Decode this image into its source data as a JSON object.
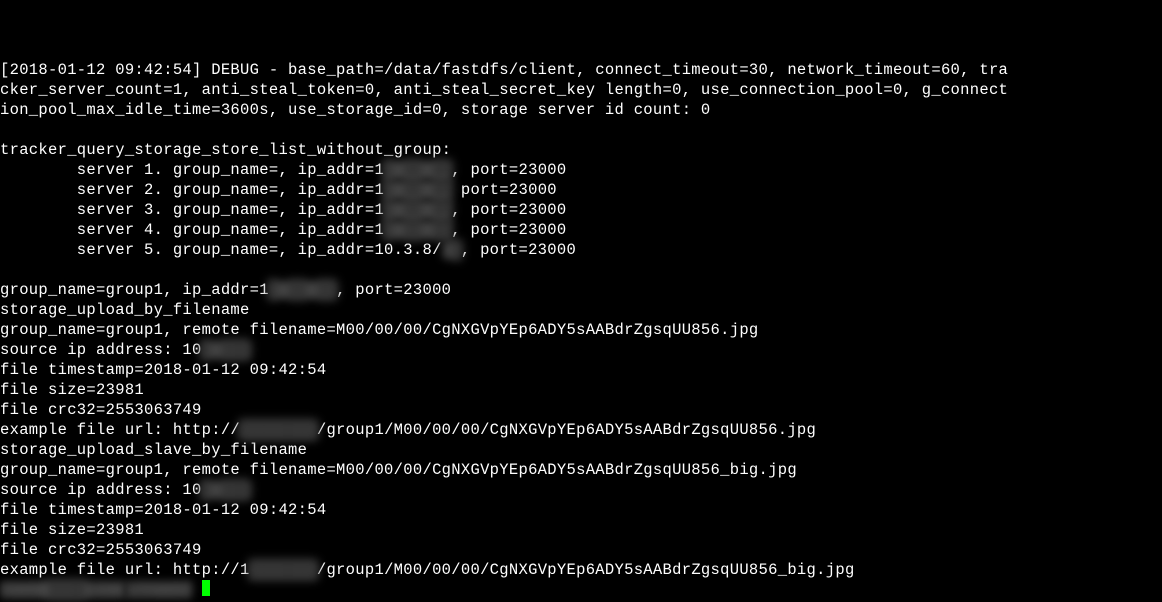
{
  "debug": {
    "ts": "[2018-01-12 09:42:54]",
    "level": "DEBUG",
    "base_path": "/data/fastdfs/client",
    "connect_timeout": "30",
    "network_timeout": "60",
    "tra": "tra",
    "cker_server_count": "cker_server_count=1",
    "anti_steal_token": "anti_steal_token=0",
    "anti_steal_secret_key_len": "anti_steal_secret_key length=0",
    "use_connection_pool": "use_connection_pool=0",
    "g_connect": "g_connect",
    "ion_pool_max_idle_time": "ion_pool_max_idle_time=3600s",
    "use_storage_id": "use_storage_id=0",
    "storage_server_id_count": "storage server id count: 0"
  },
  "tracker_header": "tracker_query_storage_store_list_without_group:",
  "servers": [
    {
      "idx": "1",
      "gn": "",
      "ip_prefix": "1",
      "ip_hidden": "█.██.██",
      "port": "23000",
      "tail": ","
    },
    {
      "idx": "2",
      "gn": "",
      "ip_prefix": "1",
      "ip_hidden": "█.██.██",
      "port": "23000",
      "tail": ""
    },
    {
      "idx": "3",
      "gn": "",
      "ip_prefix": "1",
      "ip_hidden": "█.██.██",
      "port": "23000",
      "tail": ","
    },
    {
      "idx": "4",
      "gn": "",
      "ip_prefix": "1",
      "ip_hidden": "█.██.██",
      "port": "23000",
      "tail": ","
    },
    {
      "idx": "5",
      "gn": "",
      "ip_prefix": "10.3.8/",
      "ip_hidden": ".█",
      "port": "23000",
      "tail": ","
    }
  ],
  "summary": {
    "group_name": "group1",
    "ip_prefix": "1",
    "ip_hidden": "█.██.██",
    "port": "23000"
  },
  "upload1": {
    "header": "storage_upload_by_filename",
    "group_name": "group1",
    "remote_filename": "M00/00/00/CgNXGVpYEp6ADY5sAABdrZgsqUU856.jpg",
    "source_ip_prefix": "10",
    "source_ip_hidden": "█.███",
    "timestamp": "2018-01-12 09:42:54",
    "size": "23981",
    "crc32": "2553063749",
    "url_prefix": "http://",
    "url_hidden": "████████",
    "url_path": "/group1/M00/00/00/CgNXGVpYEp6ADY5sAABdrZgsqUU856.jpg"
  },
  "upload2": {
    "header": "storage_upload_slave_by_filename",
    "group_name": "group1",
    "remote_filename": "M00/00/00/CgNXGVpYEp6ADY5sAABdrZgsqUU856_big.jpg",
    "source_ip_prefix": "10",
    "source_ip_hidden": "█.███",
    "timestamp": "2018-01-12 09:42:54",
    "size": "23981",
    "crc32": "2553063749",
    "url_prefix": "http://1",
    "url_hidden": "███████",
    "url_path": "/group1/M00/00/00/CgNXGVpYEp6ADY5sAABdrZgsqUU856_big.jpg"
  },
  "prompt": {
    "user_host_hidden": "root@████.com",
    "path_hidden": ":/root#"
  }
}
